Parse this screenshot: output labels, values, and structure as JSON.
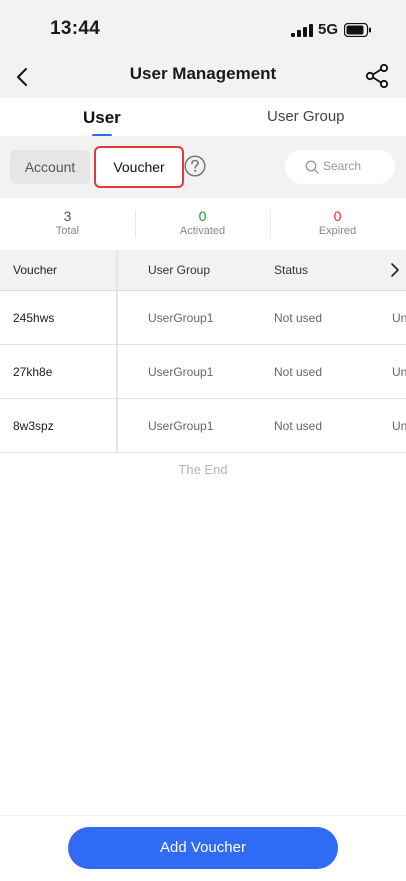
{
  "status_bar": {
    "time": "13:44",
    "network": "5G"
  },
  "nav": {
    "title": "User Management"
  },
  "tabs": [
    {
      "label": "User",
      "active": true
    },
    {
      "label": "User Group",
      "active": false
    }
  ],
  "filter": {
    "account_label": "Account",
    "voucher_label": "Voucher",
    "search_placeholder": "Search"
  },
  "stats": [
    {
      "value": "3",
      "label": "Total",
      "color": "#555555"
    },
    {
      "value": "0",
      "label": "Activated",
      "color": "#1a9a2f"
    },
    {
      "value": "0",
      "label": "Expired",
      "color": "#e5283a"
    }
  ],
  "table": {
    "headers": [
      "Voucher",
      "User Group",
      "Status"
    ],
    "rows": [
      {
        "voucher": "245hws",
        "group": "UserGroup1",
        "status": "Not used",
        "extra": "Un"
      },
      {
        "voucher": "27kh8e",
        "group": "UserGroup1",
        "status": "Not used",
        "extra": "Un"
      },
      {
        "voucher": "8w3spz",
        "group": "UserGroup1",
        "status": "Not used",
        "extra": "Un"
      }
    ]
  },
  "end_text": "The End",
  "add_button": "Add Voucher",
  "colors": {
    "accent": "#2f6bf5",
    "highlight_border": "#e03b3b"
  },
  "icons": [
    "back-icon",
    "share-icon",
    "help-icon",
    "search-icon",
    "chevron-right-icon",
    "signal-icon",
    "battery-icon"
  ]
}
